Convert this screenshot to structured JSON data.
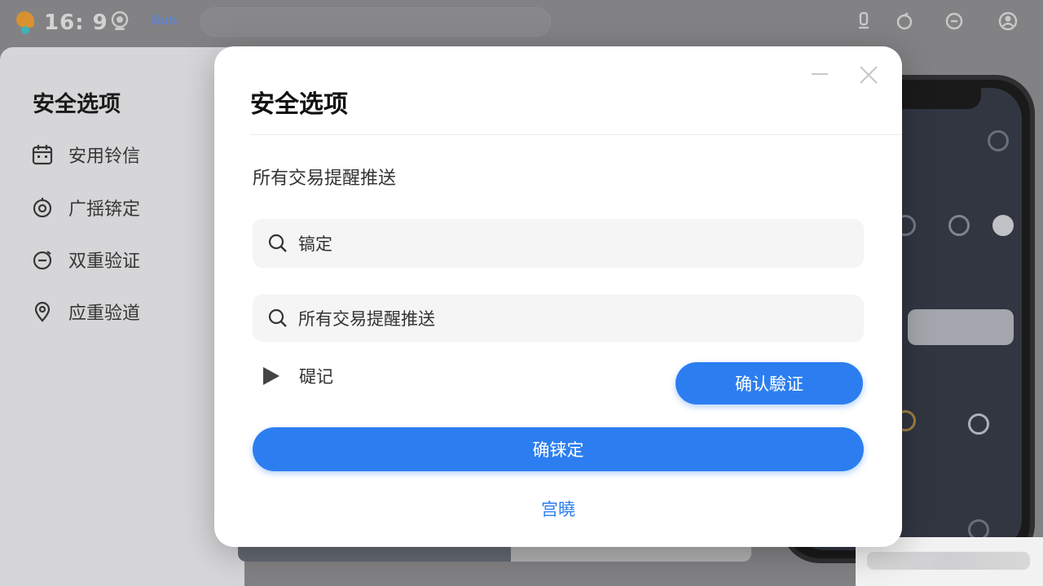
{
  "statusbar": {
    "time": "16: 9",
    "tag": "liuh",
    "icons": [
      "camera-icon",
      "mic-icon",
      "sync-icon",
      "chat-icon",
      "user-icon"
    ]
  },
  "sidebar": {
    "title": "安全选项",
    "items": [
      {
        "label": "安用铃信",
        "icon": "calendar-icon"
      },
      {
        "label": "广揺锛定",
        "icon": "target-icon"
      },
      {
        "label": "双重验证",
        "icon": "timer-icon"
      },
      {
        "label": "应重验道",
        "icon": "location-pin-icon"
      }
    ]
  },
  "dialog": {
    "title": "安全选项",
    "subtitle": "所有交易提醒推送",
    "field1_value": "镐定",
    "field2_value": "所有交易提醒推送",
    "toggle_label": "碮记",
    "verify_button": "确认驗证",
    "confirm_button": "确铼定",
    "cancel_link": "宫曉"
  },
  "colors": {
    "accent": "#2c7ef0",
    "logo_orange": "#f7a12b",
    "logo_teal": "#3ccad1"
  }
}
